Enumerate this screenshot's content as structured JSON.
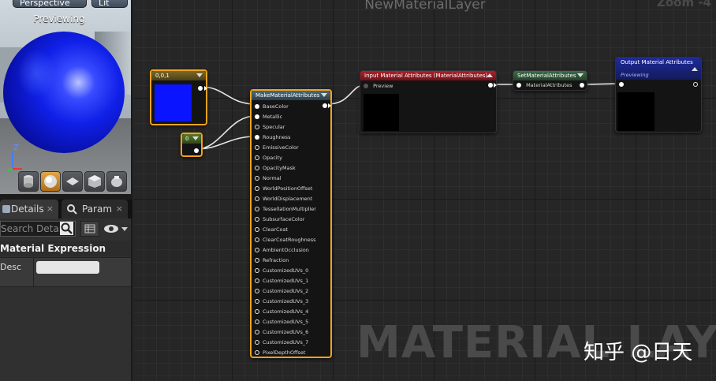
{
  "left_panel": {
    "viewport": {
      "perspective_label": "Perspective",
      "lit_label": "Lit",
      "previewing_label": "Previewing",
      "axis_z": "Z",
      "axis_x": "X"
    },
    "tabs": [
      {
        "label": "Details",
        "close": "×"
      },
      {
        "label": "Param",
        "close": "×"
      }
    ],
    "search_placeholder": "Search Details",
    "section_title": "Material Expression",
    "property_label": "Desc",
    "property_value": ""
  },
  "graph": {
    "title": "NewMaterialLayer",
    "zoom": "Zoom -4",
    "watermark": "MATERIAL LAYER",
    "overlay_text": "知乎 @日天",
    "nodes": {
      "const3": {
        "title": "0,0,1",
        "color": "#0a14ff"
      },
      "const1": {
        "title": "0"
      },
      "make": {
        "title": "MakeMaterialAttributes",
        "inputs": [
          "BaseColor",
          "Metallic",
          "Specular",
          "Roughness",
          "EmissiveColor",
          "Opacity",
          "OpacityMask",
          "Normal",
          "WorldPositionOffset",
          "WorldDisplacement",
          "TessellationMultiplier",
          "SubsurfaceColor",
          "ClearCoat",
          "ClearCoatRoughness",
          "AmbientOcclusion",
          "Refraction",
          "CustomizedUVs_0",
          "CustomizedUVs_1",
          "CustomizedUVs_2",
          "CustomizedUVs_3",
          "CustomizedUVs_4",
          "CustomizedUVs_5",
          "CustomizedUVs_6",
          "CustomizedUVs_7",
          "PixelDepthOffset"
        ]
      },
      "input_attr": {
        "title": "Input Material Attributes (MaterialAttributes)",
        "pin": "Preview"
      },
      "set_attr": {
        "title": "SetMaterialAttributes",
        "pin": "MaterialAttributes"
      },
      "output_attr": {
        "title": "Output Material Attributes",
        "subtitle": "Previewing"
      }
    }
  }
}
